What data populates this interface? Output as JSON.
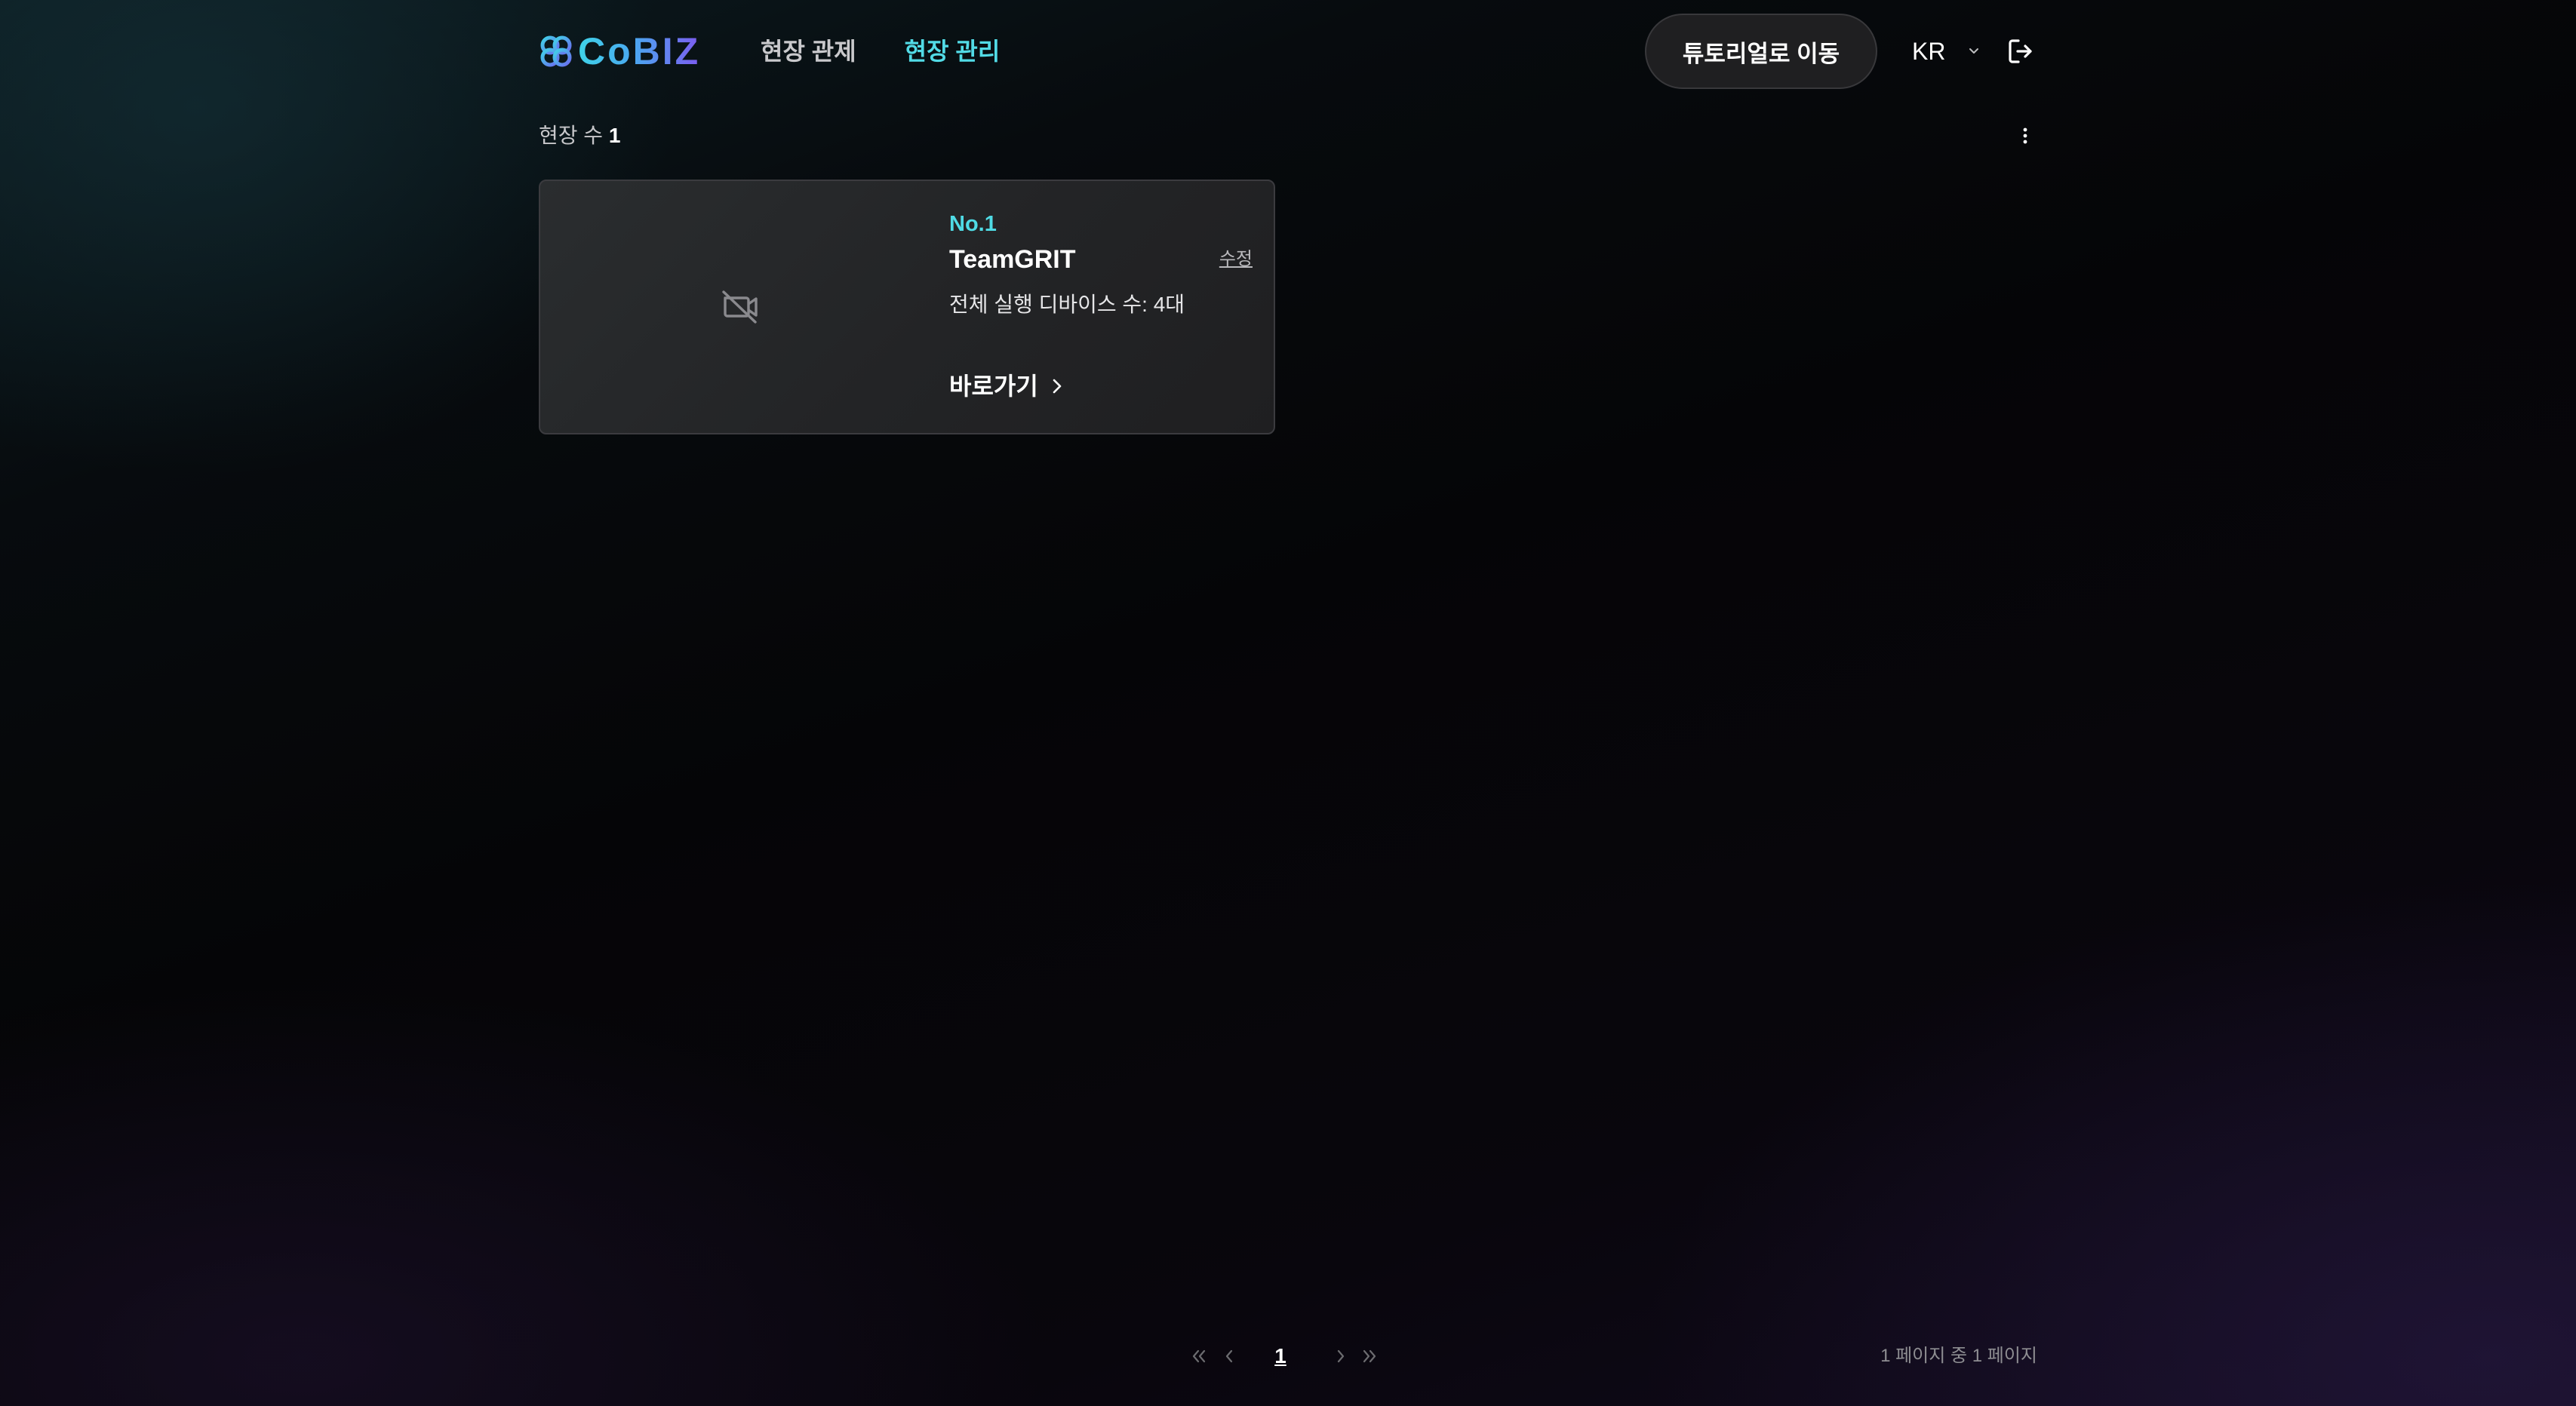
{
  "app": {
    "brand": "CoBIZ"
  },
  "nav": {
    "items": [
      {
        "label": "현장 관제",
        "active": false
      },
      {
        "label": "현장 관리",
        "active": true
      }
    ]
  },
  "header": {
    "tutorial_button": "튜토리얼로 이동",
    "language": "KR",
    "icons": [
      "chevron-down-icon",
      "logout-icon"
    ]
  },
  "summary": {
    "count_label": "현장 수",
    "count_value": "1",
    "menu_icon": "more-vertical-icon"
  },
  "sites": [
    {
      "number": "No.1",
      "name": "TeamGRIT",
      "edit_label": "수정",
      "devices": "전체 실행 디바이스 수: 4대",
      "go_label": "바로가기",
      "thumbnail_icon": "video-off-icon"
    }
  ],
  "pagination": {
    "current_page": "1",
    "info": "1 페이지 중 1 페이지",
    "icons": [
      "double-chevron-left-icon",
      "chevron-left-icon",
      "chevron-right-icon",
      "double-chevron-right-icon"
    ]
  },
  "colors": {
    "accent": "#52dbe6",
    "card_bg": "#232426",
    "button_bg": "#1f1f21"
  }
}
